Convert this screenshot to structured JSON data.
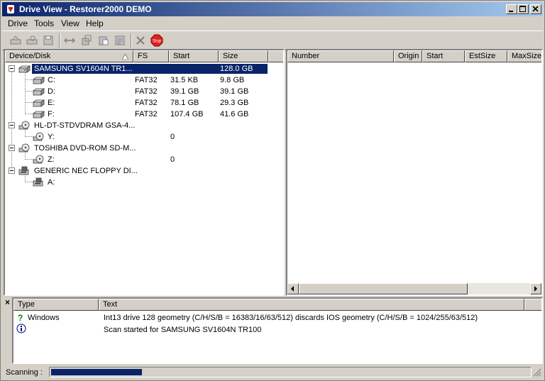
{
  "window": {
    "title": "Drive View - Restorer2000 DEMO"
  },
  "menu": [
    "Drive",
    "Tools",
    "View",
    "Help"
  ],
  "toolbar": {
    "stop_label": "Stop"
  },
  "tree": {
    "columns": [
      "Device/Disk",
      "FS",
      "Start",
      "Size"
    ],
    "rows": [
      {
        "name": "SAMSUNG SV1604N TR1...",
        "fs": "",
        "start": "",
        "size": "128.0 GB"
      },
      {
        "name": "C:",
        "fs": "FAT32",
        "start": "31.5 KB",
        "size": "9.8 GB"
      },
      {
        "name": "D:",
        "fs": "FAT32",
        "start": "39.1 GB",
        "size": "39.1 GB"
      },
      {
        "name": "E:",
        "fs": "FAT32",
        "start": "78.1 GB",
        "size": "29.3 GB"
      },
      {
        "name": "F:",
        "fs": "FAT32",
        "start": "107.4 GB",
        "size": "41.6 GB"
      },
      {
        "name": "HL-DT-STDVDRAM GSA-4...",
        "fs": "",
        "start": "",
        "size": ""
      },
      {
        "name": "Y:",
        "fs": "",
        "start": "0",
        "size": ""
      },
      {
        "name": "TOSHIBA DVD-ROM SD-M...",
        "fs": "",
        "start": "",
        "size": ""
      },
      {
        "name": "Z:",
        "fs": "",
        "start": "0",
        "size": ""
      },
      {
        "name": "GENERIC NEC FLOPPY DI...",
        "fs": "",
        "start": "",
        "size": ""
      },
      {
        "name": "A:",
        "fs": "",
        "start": "",
        "size": ""
      }
    ]
  },
  "right": {
    "columns": [
      "Number",
      "Origin",
      "Start",
      "EstSize",
      "MaxSize"
    ]
  },
  "log": {
    "close_glyph": "×",
    "columns": [
      "Type",
      "Text"
    ],
    "rows": [
      {
        "type": "Windows",
        "text": "Int13 drive 128 geometry (C/H/S/B = 16383/16/63/512) discards IOS geometry (C/H/S/B = 1024/255/63/512)"
      },
      {
        "type": "",
        "text": "Scan started for SAMSUNG SV1604N TR100"
      }
    ]
  },
  "status": {
    "label": "Scanning :",
    "progress": 0.19
  },
  "colors": {
    "selection": "#0a246a",
    "progress": "#0a246a",
    "stop": "#e02020"
  }
}
